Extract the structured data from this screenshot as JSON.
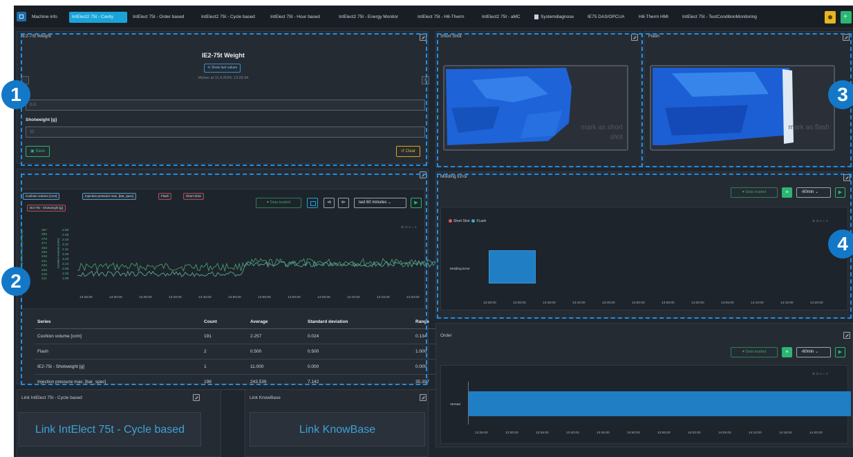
{
  "tabs": [
    {
      "label": "Machine info"
    },
    {
      "label": "IntElect2 75t - Cavity"
    },
    {
      "label": "IntElect 75t - Order based"
    },
    {
      "label": "IntElect2 75t - Cycle based"
    },
    {
      "label": "IntElect 75t - Hour based"
    },
    {
      "label": "IntElect2 75t - Energy Monitor"
    },
    {
      "label": "IntElect 75t - H8-Therm"
    },
    {
      "label": "IntElect2 75t - aMC"
    },
    {
      "label": "Systemdiagnose"
    },
    {
      "label": "IE75 DAS/OPCUA"
    },
    {
      "label": "H8-Therm HMI"
    },
    {
      "label": "IntElect 75t - TestConditionMonitoring"
    }
  ],
  "weight_panel": {
    "title": "IE2-75t Weight",
    "heading": "IE2-75t Weight",
    "show_last_values": "Show last values",
    "meta": "Molser at 11.4.2024, 13:25:34",
    "field1_value": "0.0",
    "shotweight_label": "Shotweight [g]",
    "shotweight_value": "11",
    "save_label": "Save",
    "clear_label": "Clear"
  },
  "trend_panel": {
    "chips": [
      {
        "label": "Cushion volume [ccm]",
        "color": "blue"
      },
      {
        "label": "Injection pressure max. [bar_spec]",
        "color": "blue"
      },
      {
        "label": "Flash",
        "color": "red"
      },
      {
        "label": "Short Shot",
        "color": "red"
      },
      {
        "label": "IE2-75t - Shotweight [g]",
        "color": "red"
      }
    ],
    "data_loaded": "Data loaded",
    "range": "last 60 minutes",
    "left_axis_label": "Injection pressure max. [bar_spec]",
    "right_axis_label": "Cushion volume [ccm]",
    "pressure_ticks": [
      "287",
      "280",
      "279",
      "271",
      "263",
      "255",
      "249",
      "241",
      "233",
      "225",
      "219",
      "211"
    ],
    "cushion_ticks": [
      "2.55",
      "2.46",
      "2.43",
      "2.37",
      "2.31",
      "2.26",
      "2.20",
      "2.14",
      "2.08",
      "2.02",
      "1.96"
    ],
    "x_ticks": [
      "13:25:00",
      "13:30:00",
      "13:35:00",
      "13:40:00",
      "13:45:00",
      "13:50:00",
      "13:55:00",
      "14:00:00",
      "14:05:00",
      "14:10:00",
      "14:15:00",
      "14:20:00"
    ]
  },
  "stats_table": {
    "headers": [
      "Series",
      "Count",
      "Average",
      "Standard deviation",
      "Range"
    ],
    "rows": [
      [
        "Cushion volume [ccm]",
        "191",
        "2.257",
        "0.024",
        "0.134"
      ],
      [
        "Flash",
        "2",
        "0.500",
        "0.500",
        "1.000"
      ],
      [
        "IE2-75t - Shotweight [g]",
        "1",
        "11.000",
        "0.000",
        "0.000"
      ],
      [
        "Injection pressure max. [bar_spec]",
        "198",
        "243.539",
        "7.142",
        "35.397"
      ]
    ]
  },
  "links": [
    {
      "title": "Link IntElect 75t - Cycle based",
      "text": "Link IntElect 75t - Cycle based"
    },
    {
      "title": "Link KnowBase",
      "text": "Link KnowBase"
    }
  ],
  "short_shot": {
    "title": "Short Shot",
    "mark": "mark as short shot"
  },
  "flash": {
    "title": "Flash",
    "mark": "mark as flash"
  },
  "molding_error": {
    "title": "Molding Error",
    "data_loaded": "Data loaded",
    "range": "-60min",
    "legend": [
      {
        "label": "Short Shot",
        "color": "#e05a5a"
      },
      {
        "label": "FLash",
        "color": "#3ea2d8"
      }
    ],
    "y_label": "Molding Error",
    "x_ticks": [
      "13:26:00",
      "13:30:00",
      "13:35:00",
      "13:40:00",
      "13:45:00",
      "13:50:00",
      "13:55:00",
      "14:00:00",
      "14:05:00",
      "14:10:00",
      "14:15:00",
      "14:20:00"
    ]
  },
  "order": {
    "title": "Order",
    "data_loaded": "Data loaded",
    "range": "-60min",
    "y_label": "Versad",
    "x_ticks": [
      "13:25:00",
      "13:30:00",
      "13:35:00",
      "13:40:00",
      "13:45:00",
      "13:50:00",
      "13:55:00",
      "14:00:00",
      "14:05:00",
      "14:10:00",
      "14:15:00",
      "14:20:00"
    ]
  },
  "badges": [
    "1",
    "2",
    "3",
    "4"
  ],
  "colors": {
    "accent": "#1aa3d9",
    "green": "#2bb673",
    "badge": "#1478c8",
    "dash": "#1e8fe6",
    "trend_green": "#4a9a6a",
    "trend_teal": "#5aa7a0"
  }
}
